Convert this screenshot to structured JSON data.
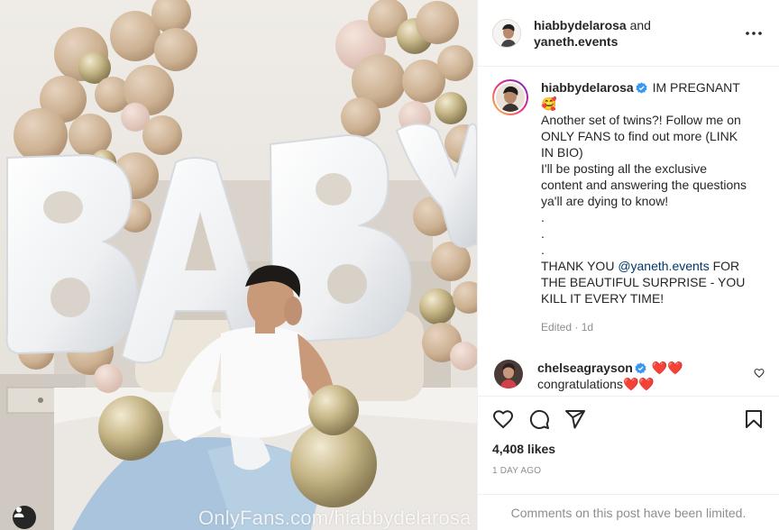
{
  "photo": {
    "alt_icon": "user-tag-icon",
    "watermark": "OnlyFans.com/hiabbydelarosa",
    "letters": [
      "B",
      "A",
      "B",
      "Y"
    ]
  },
  "header": {
    "user1": "hiabbydelarosa",
    "and_text": "and",
    "user2": "yaneth.events",
    "more_icon": "more-options-icon"
  },
  "caption": {
    "username": "hiabbydelarosa",
    "first_line": "IM PREGNANT",
    "emoji": "🥰",
    "lines": [
      "Another set of twins?! Follow me on ONLY FANS to find out more (LINK IN BIO)",
      "I'll be posting all the exclusive content and answering the questions ya'll are dying to know!",
      ".",
      ".",
      "."
    ],
    "thanks_prefix": "THANK YOU ",
    "thanks_mention": "@yaneth.events",
    "thanks_suffix": " FOR THE BEAUTIFUL SURPRISE - YOU KILL IT EVERY TIME!",
    "meta": "Edited · 1d"
  },
  "comment": {
    "username": "chelseagrayson",
    "hearts": "❤️❤️",
    "text": "congratulations",
    "text_hearts": "❤️❤️"
  },
  "actions": {
    "like_icon": "heart-icon",
    "comment_icon": "comment-icon",
    "share_icon": "share-icon",
    "save_icon": "bookmark-icon"
  },
  "likes": "4,408 likes",
  "date": "1 DAY AGO",
  "limited": "Comments on this post have been limited.",
  "colors": {
    "mention": "#00376b",
    "verified": "#3897f0",
    "muted": "#8e8e8e"
  }
}
